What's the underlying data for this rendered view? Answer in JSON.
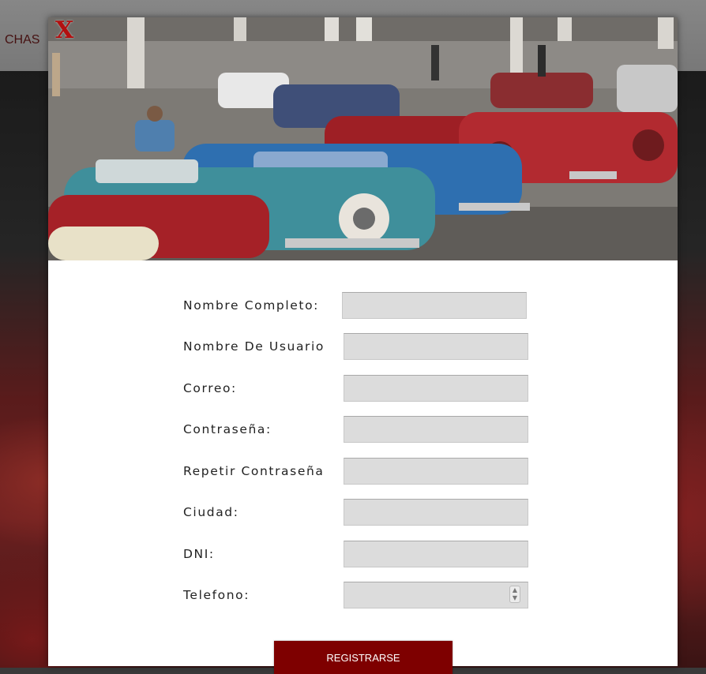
{
  "background": {
    "nav_text": "CHAS"
  },
  "modal": {
    "close_symbol": "X",
    "hero_image": "classic-cars-photo"
  },
  "form": {
    "fields": [
      {
        "label": "Nombre Completo:",
        "value": ""
      },
      {
        "label": "Nombre De Usuario",
        "value": ""
      },
      {
        "label": "Correo:",
        "value": ""
      },
      {
        "label": "Contraseña:",
        "value": ""
      },
      {
        "label": "Repetir Contraseña",
        "value": ""
      },
      {
        "label": "Ciudad:",
        "value": ""
      },
      {
        "label": "DNI:",
        "value": ""
      },
      {
        "label": "Telefono:",
        "value": ""
      }
    ],
    "submit_label": "REGISTRARSE"
  },
  "colors": {
    "accent": "#7e0000",
    "close": "#b21010",
    "input_bg": "#dcdcdc"
  }
}
